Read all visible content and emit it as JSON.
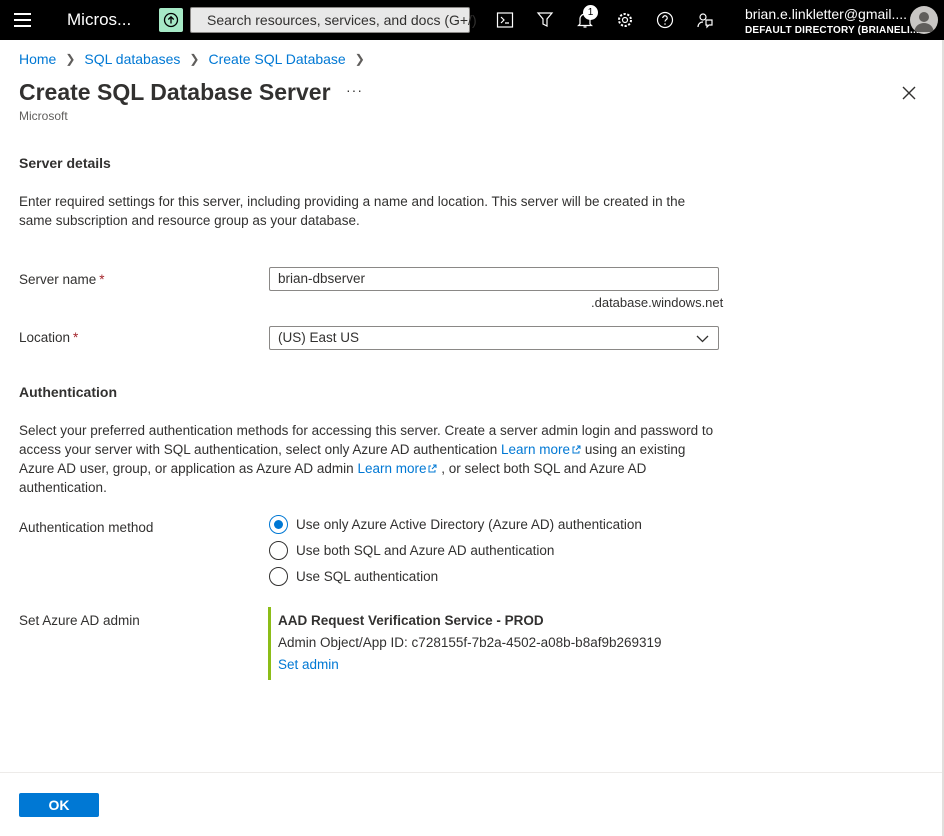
{
  "topbar": {
    "app_title": "Micros...",
    "search_placeholder": "Search resources, services, and docs (G+/)",
    "notification_count": "1",
    "user_name": "brian.e.linkletter@gmail....",
    "user_directory": "DEFAULT DIRECTORY (BRIANELI..."
  },
  "breadcrumb": [
    "Home",
    "SQL databases",
    "Create SQL Database"
  ],
  "page": {
    "title": "Create SQL Database Server",
    "more": "···",
    "subtitle": "Microsoft"
  },
  "server_details": {
    "heading": "Server details",
    "description": "Enter required settings for this server, including providing a name and location. This server will be created in the same subscription and resource group as your database.",
    "server_name_label": "Server name",
    "server_name_value": "brian-dbserver",
    "server_name_suffix": ".database.windows.net",
    "location_label": "Location",
    "location_value": "(US) East US",
    "required_marker": "*"
  },
  "authentication": {
    "heading": "Authentication",
    "desc_part1": "Select your preferred authentication methods for accessing this server. Create a server admin login and password to access your server with SQL authentication, select only Azure AD authentication ",
    "learn_more_1": "Learn more",
    "desc_part2": " using an existing Azure AD user, group, or application as Azure AD admin ",
    "learn_more_2": "Learn more",
    "desc_part3": " , or select both SQL and Azure AD authentication.",
    "method_label": "Authentication method",
    "options": [
      {
        "label": "Use only Azure Active Directory (Azure AD) authentication",
        "checked": true
      },
      {
        "label": "Use both SQL and Azure AD authentication",
        "checked": false
      },
      {
        "label": "Use SQL authentication",
        "checked": false
      }
    ],
    "admin_label": "Set Azure AD admin",
    "admin_name": "AAD Request Verification Service - PROD",
    "admin_id": "Admin Object/App ID: c728155f-7b2a-4502-a08b-b8af9b269319",
    "set_admin_link": "Set admin"
  },
  "footer": {
    "ok_label": "OK"
  },
  "colors": {
    "accent": "#0078d4",
    "admin_bar": "#8cbd18",
    "required": "#a4262c"
  }
}
